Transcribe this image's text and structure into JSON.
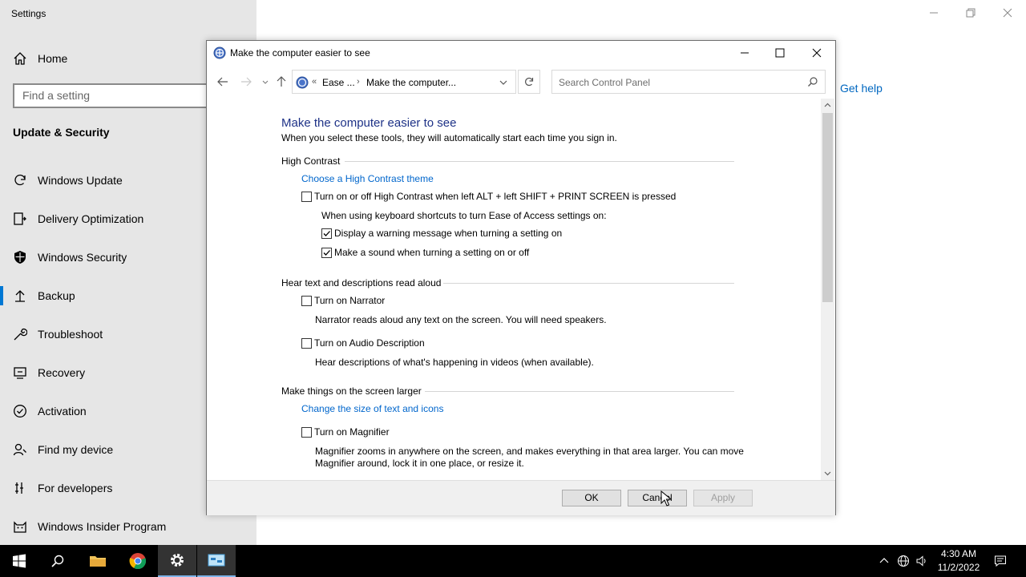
{
  "settings": {
    "window_title": "Settings",
    "home_label": "Home",
    "search_placeholder": "Find a setting",
    "section_title": "Update & Security",
    "nav_items": [
      {
        "label": "Windows Update",
        "icon": "refresh-icon"
      },
      {
        "label": "Delivery Optimization",
        "icon": "delivery-icon"
      },
      {
        "label": "Windows Security",
        "icon": "shield-icon"
      },
      {
        "label": "Backup",
        "icon": "backup-arrow-icon"
      },
      {
        "label": "Troubleshoot",
        "icon": "wrench-icon"
      },
      {
        "label": "Recovery",
        "icon": "recovery-icon"
      },
      {
        "label": "Activation",
        "icon": "check-circle-icon"
      },
      {
        "label": "Find my device",
        "icon": "person-locate-icon"
      },
      {
        "label": "For developers",
        "icon": "developer-icon"
      },
      {
        "label": "Windows Insider Program",
        "icon": "insider-cat-icon"
      }
    ],
    "selected_item": "Backup",
    "get_help": "Get help"
  },
  "dialog": {
    "title": "Make the computer easier to see",
    "breadcrumb": [
      "Ease ...",
      "Make the computer..."
    ],
    "breadcrumb_prefix": "«",
    "search_placeholder": "Search Control Panel",
    "heading": "Make the computer easier to see",
    "intro": "When you select these tools, they will automatically start each time you sign in.",
    "groups": {
      "high_contrast": {
        "title": "High Contrast",
        "link": "Choose a High Contrast theme",
        "toggle_label": "Turn on or off High Contrast when left ALT + left SHIFT + PRINT SCREEN is pressed",
        "toggle_checked": false,
        "shortcut_note": "When using keyboard shortcuts to turn Ease of Access settings on:",
        "warning_label": "Display a warning message when turning a setting on",
        "warning_checked": true,
        "sound_label": "Make a sound when turning a setting on or off",
        "sound_checked": true
      },
      "read_aloud": {
        "title": "Hear text and descriptions read aloud",
        "narrator_label": "Turn on Narrator",
        "narrator_checked": false,
        "narrator_desc": "Narrator reads aloud any text on the screen. You will need speakers.",
        "audio_desc_label": "Turn on Audio Description",
        "audio_desc_checked": false,
        "audio_desc_desc": "Hear descriptions of what's happening in videos (when available)."
      },
      "larger": {
        "title": "Make things on the screen larger",
        "link": "Change the size of text and icons",
        "magnifier_label": "Turn on Magnifier",
        "magnifier_checked": false,
        "magnifier_desc_1": "Magnifier zooms in anywhere on the screen, and makes everything in that area larger. You can move",
        "magnifier_desc_2": "Magnifier around, lock it in one place, or resize it."
      }
    },
    "buttons": {
      "ok": "OK",
      "cancel": "Cancel",
      "apply": "Apply"
    }
  },
  "taskbar": {
    "time": "4:30 AM",
    "date": "11/2/2022"
  },
  "colors": {
    "accent": "#0078d4",
    "link": "#0066cc",
    "heading": "#1e3287"
  }
}
